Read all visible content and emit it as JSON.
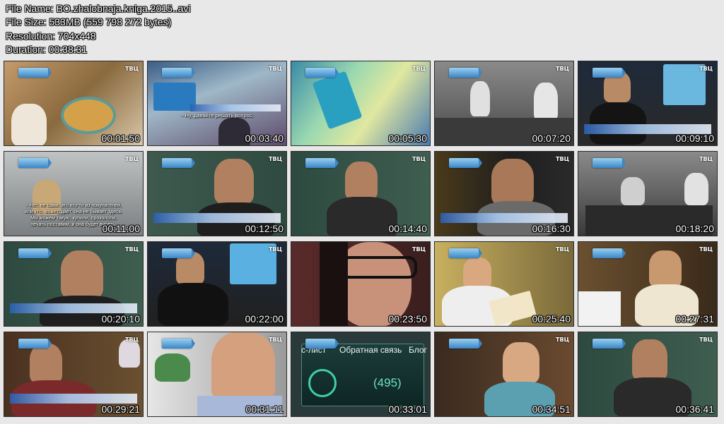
{
  "header": {
    "file_name": "File Name: BO.zhalobnaja.kniga.2015..avi",
    "file_size": "File Size: 533MB (559 798 272 bytes)",
    "resolution": "Resolution: 704x448",
    "duration": "Duration: 00:38:31"
  },
  "thumbnails": [
    {
      "time": "00:01:50"
    },
    {
      "time": "00:03:40"
    },
    {
      "time": "00:05:30"
    },
    {
      "time": "00:07:20"
    },
    {
      "time": "00:09:10"
    },
    {
      "time": "00:11:00"
    },
    {
      "time": "00:12:50"
    },
    {
      "time": "00:14:40"
    },
    {
      "time": "00:16:30"
    },
    {
      "time": "00:18:20"
    },
    {
      "time": "00:20:10"
    },
    {
      "time": "00:22:00"
    },
    {
      "time": "00:23:50"
    },
    {
      "time": "00:25:40"
    },
    {
      "time": "00:27:31"
    },
    {
      "time": "00:29:21"
    },
    {
      "time": "00:31:11"
    },
    {
      "time": "00:33:01"
    },
    {
      "time": "00:34:51"
    },
    {
      "time": "00:36:41"
    }
  ],
  "overlays": {
    "subtitle_2": "– Ну, давайте решать вопрос.",
    "subtitle_6_l1": "– Нет, не сами, это кто-то из покупателей,",
    "subtitle_6_l2": "или кто, может, даёт, она не бывает здесь.",
    "subtitle_6_l3": "Мы можем такую, купили, прокололи,",
    "subtitle_6_l4": "печать поставим, и она будет висеть.",
    "menu_left": "с-лист",
    "menu_center": "Обратная связь",
    "menu_right": "Блог",
    "phone_number": "(495)",
    "channel_badge": "ТВЦ"
  },
  "colors": {
    "background": "#e8e8e8",
    "timestamp_text": "#ffffff",
    "badge_blue": "#3a86c8"
  }
}
